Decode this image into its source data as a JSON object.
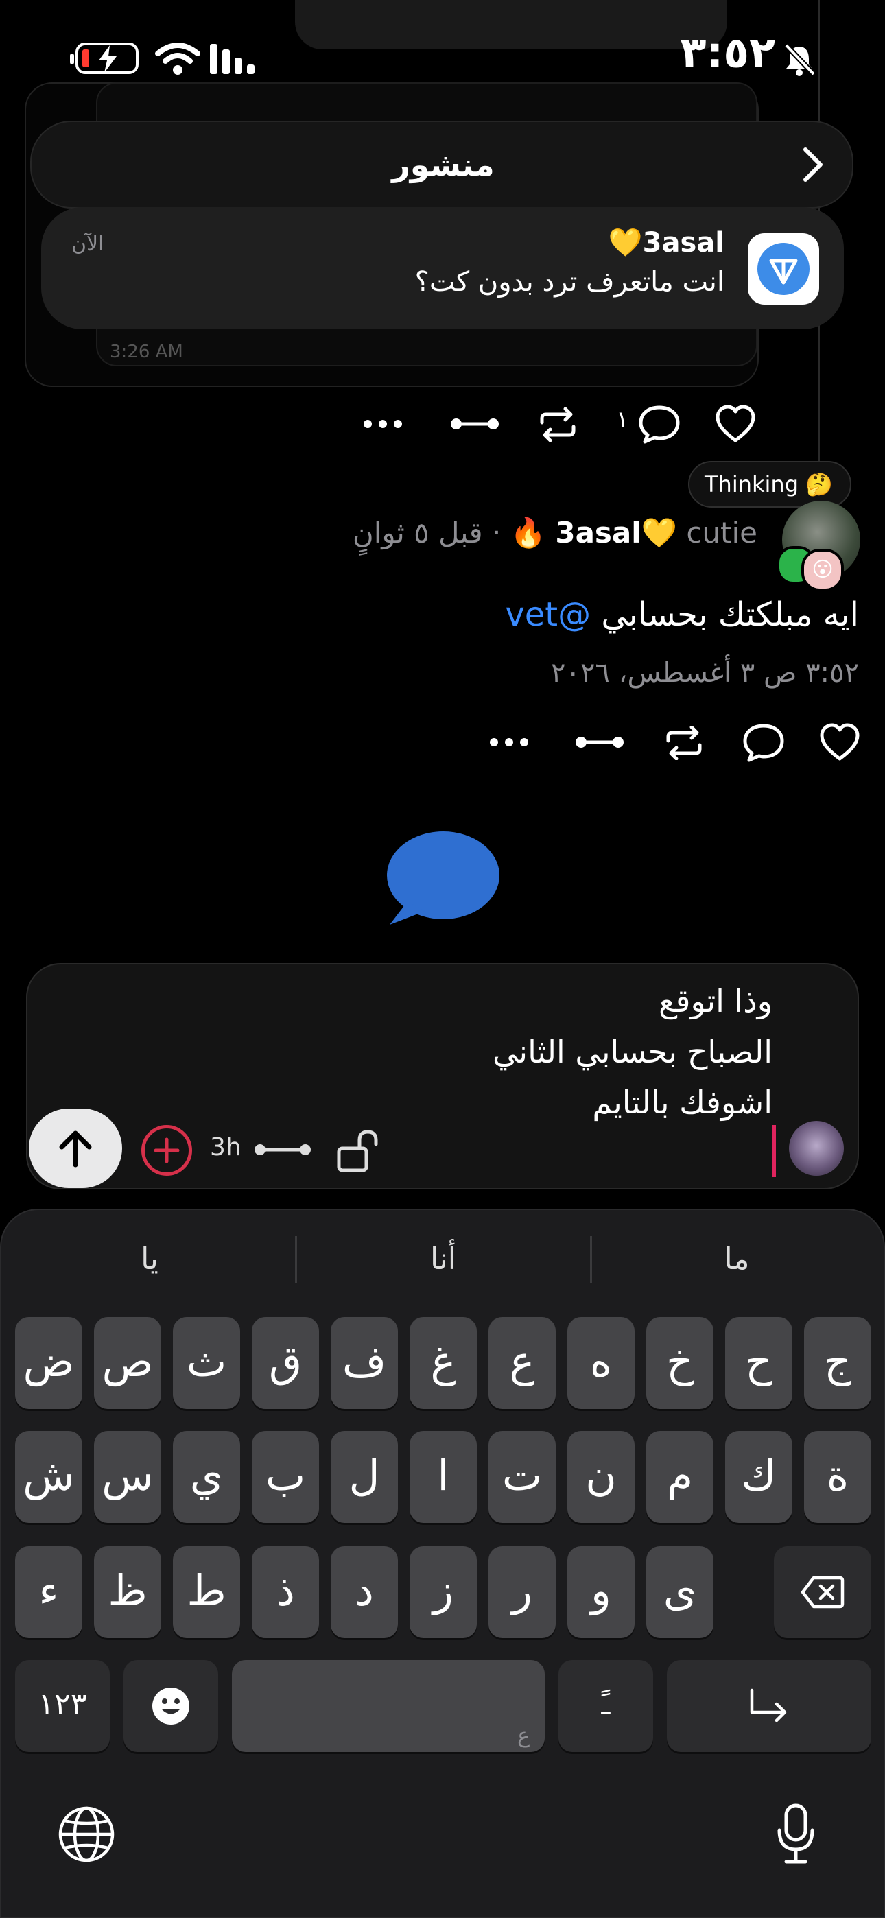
{
  "status_bar": {
    "time": "٣:٥٢"
  },
  "background_post": {
    "timestamp": "3:26 AM"
  },
  "header": {
    "title": "منشور"
  },
  "notification": {
    "app_icon": "ton-wallet-icon",
    "title": "3asal💛",
    "body": "انت ماتعرف ترد بدون كت؟",
    "time": "الآن"
  },
  "action_row_top": {
    "reply_count": "١"
  },
  "thinking_badge": {
    "label": "Thinking 🤔"
  },
  "post": {
    "author_name": "3asal💛",
    "author_handle": "cutie",
    "relative_time": "قبل ٥ ثوانٍ",
    "text": "ايه مبلكتك بحسابي",
    "mention": "@vet",
    "date": "٣:٥٢ ص ٣ أغسطس، ٢٠٢٦"
  },
  "composer": {
    "lines": [
      "وذا اتوقع",
      "الصباح بحسابي الثاني",
      "اشوفك بالتايم"
    ],
    "ttl_label": "3h"
  },
  "keyboard": {
    "suggestions": [
      "ما",
      "أنا",
      "يا"
    ],
    "row1": [
      "ج",
      "ح",
      "خ",
      "ه",
      "ع",
      "غ",
      "ف",
      "ق",
      "ث",
      "ص",
      "ض"
    ],
    "row2": [
      "ة",
      "ك",
      "م",
      "ن",
      "ت",
      "ا",
      "ل",
      "ب",
      "ي",
      "س",
      "ش"
    ],
    "row3": [
      "ى",
      "و",
      "ر",
      "ز",
      "د",
      "ذ",
      "ط",
      "ظ",
      "ء"
    ],
    "numbers_key": "١٢٣",
    "space_hint": "ع",
    "tanween_key": "ـً"
  },
  "colors": {
    "accent_blue": "#3a8bff",
    "like_red": "#d6304a",
    "battery_low": "#ff3b30",
    "bubble_blue": "#2f6fd1"
  }
}
